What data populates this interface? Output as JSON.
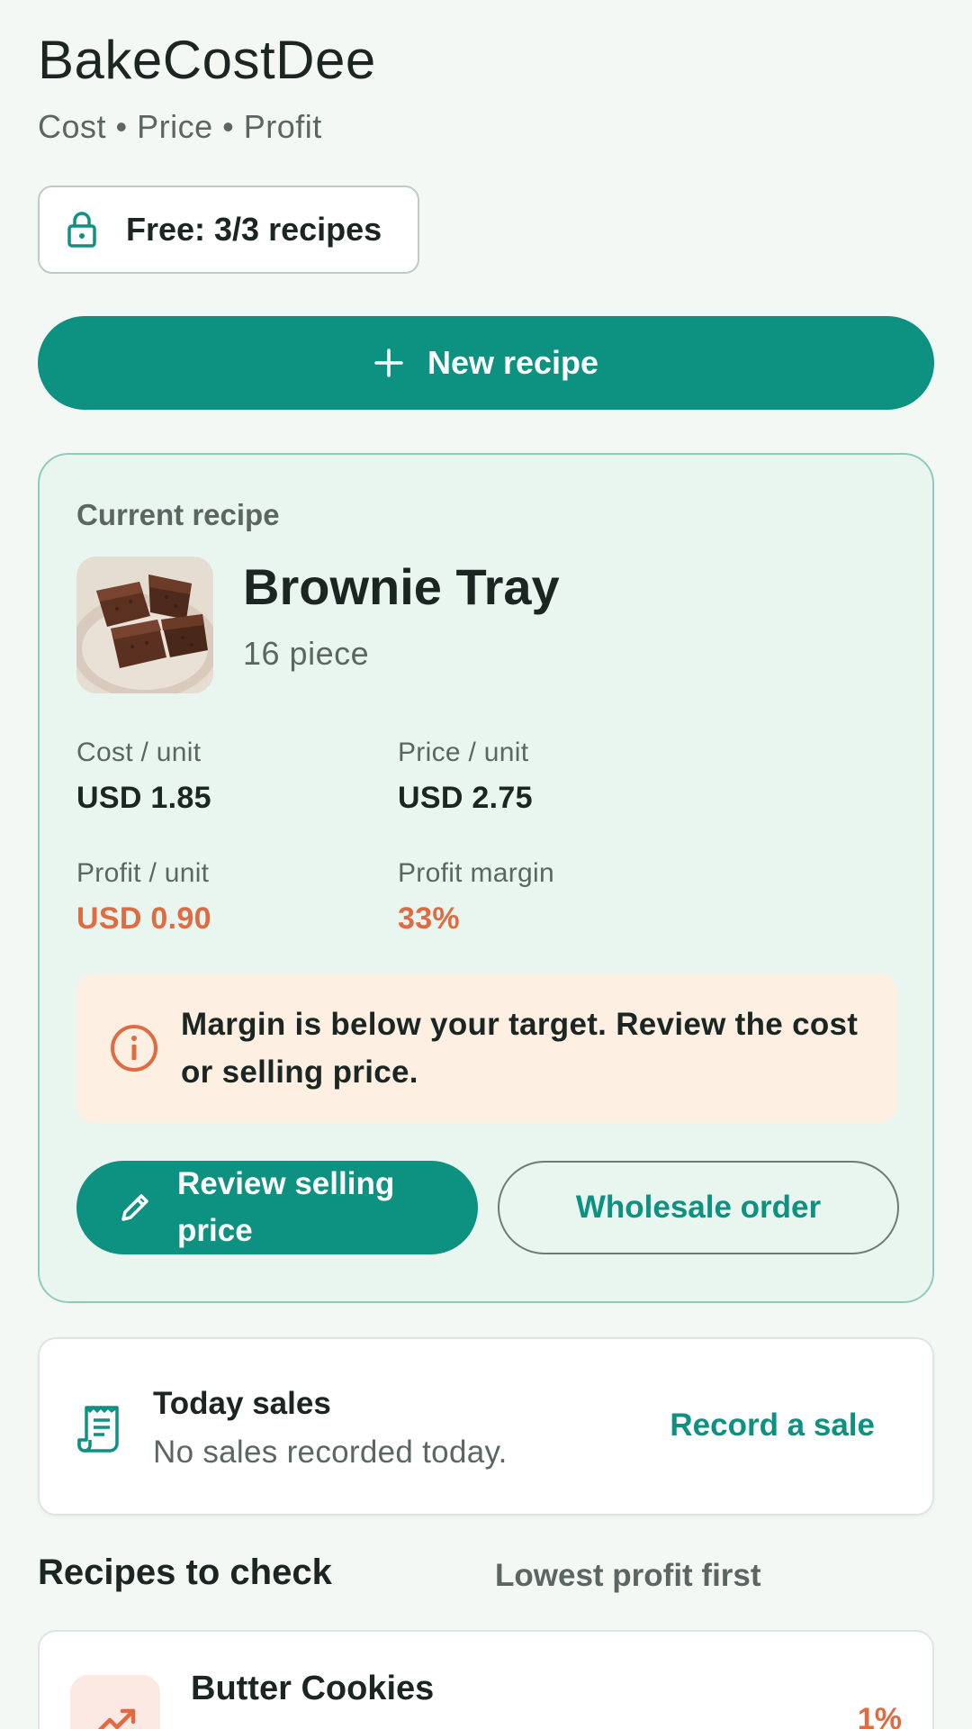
{
  "header": {
    "title": "BakeCostDee",
    "subtitle": "Cost • Price • Profit"
  },
  "plan_chip": {
    "icon": "lock-icon",
    "label": "Free: 3/3 recipes"
  },
  "new_recipe_button": {
    "icon": "plus-icon",
    "label": "New recipe"
  },
  "current_recipe": {
    "eyebrow": "Current recipe",
    "name": "Brownie Tray",
    "yield": "16 piece",
    "metrics": {
      "cost_label": "Cost / unit",
      "cost_value": "USD 1.85",
      "price_label": "Price / unit",
      "price_value": "USD 2.75",
      "profit_label": "Profit / unit",
      "profit_value": "USD 0.90",
      "margin_label": "Profit margin",
      "margin_value": "33%"
    },
    "warning": {
      "icon": "info-icon",
      "text": "Margin is below your target. Review the cost or selling price."
    },
    "primary_action": {
      "icon": "pencil-icon",
      "label": "Review selling price"
    },
    "secondary_action": {
      "label": "Wholesale order"
    }
  },
  "sales": {
    "icon": "receipt-icon",
    "title": "Today sales",
    "description": "No sales recorded today.",
    "action": "Record a sale"
  },
  "recipes_to_check": {
    "title": "Recipes to check",
    "sort": "Lowest profit first",
    "items": [
      {
        "icon": "trending-up-icon",
        "name": "Butter Cookies",
        "margin": "1%"
      }
    ]
  },
  "colors": {
    "accent": "#0d9180",
    "warning": "#e06b42",
    "card_bg": "#e9f6ef",
    "page_bg": "#f3f8f5"
  }
}
